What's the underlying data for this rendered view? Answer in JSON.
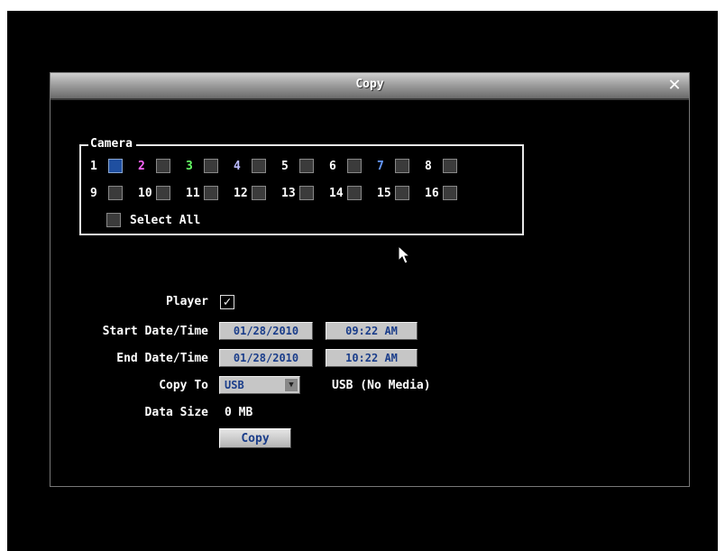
{
  "window": {
    "title": "Copy"
  },
  "camera_group": {
    "legend": "Camera",
    "row1": [
      {
        "num": "1",
        "color": "#ffffff",
        "checked": true
      },
      {
        "num": "2",
        "color": "#ff66ff"
      },
      {
        "num": "3",
        "color": "#66ff66"
      },
      {
        "num": "4",
        "color": "#bbbbff"
      },
      {
        "num": "5",
        "color": "#ffffff"
      },
      {
        "num": "6",
        "color": "#ffffff"
      },
      {
        "num": "7",
        "color": "#6699ff"
      },
      {
        "num": "8",
        "color": "#ffffff"
      }
    ],
    "row2": [
      {
        "num": "9",
        "color": "#ffffff"
      },
      {
        "num": "10",
        "color": "#ffffff"
      },
      {
        "num": "11",
        "color": "#ffffff"
      },
      {
        "num": "12",
        "color": "#ffffff"
      },
      {
        "num": "13",
        "color": "#ffffff"
      },
      {
        "num": "14",
        "color": "#ffffff"
      },
      {
        "num": "15",
        "color": "#ffffff"
      },
      {
        "num": "16",
        "color": "#ffffff"
      }
    ],
    "select_all_label": "Select All"
  },
  "form": {
    "player_label": "Player",
    "player_checked": true,
    "start_label": "Start Date/Time",
    "start_date": "01/28/2010",
    "start_time": "09:22 AM",
    "end_label": "End Date/Time",
    "end_date": "01/28/2010",
    "end_time": "10:22 AM",
    "copy_to_label": "Copy To",
    "copy_to_value": "USB",
    "copy_to_status": "USB (No Media)",
    "data_size_label": "Data Size",
    "data_size_value": "0 MB",
    "copy_button": "Copy"
  }
}
